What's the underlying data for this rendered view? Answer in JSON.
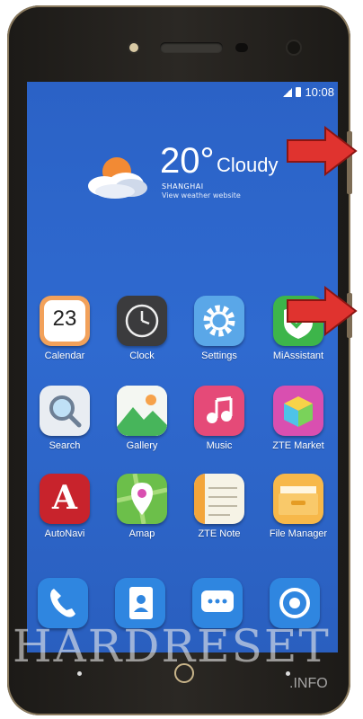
{
  "status": {
    "time": "10:08"
  },
  "weather": {
    "temperature": "20°",
    "condition": "Cloudy",
    "city": "SHANGHAI",
    "subtitle": "View weather website"
  },
  "apps": [
    {
      "label": "Calendar",
      "icon": "calendar-icon",
      "day": "23"
    },
    {
      "label": "Clock",
      "icon": "clock-icon"
    },
    {
      "label": "Settings",
      "icon": "gear-icon"
    },
    {
      "label": "MiAssistant",
      "icon": "shield-icon"
    },
    {
      "label": "Search",
      "icon": "search-icon"
    },
    {
      "label": "Gallery",
      "icon": "gallery-icon"
    },
    {
      "label": "Music",
      "icon": "music-icon"
    },
    {
      "label": "ZTE Market",
      "icon": "cube-icon"
    },
    {
      "label": "AutoNavi",
      "icon": "autonavi-icon",
      "glyph": "A"
    },
    {
      "label": "Amap",
      "icon": "map-pin-icon"
    },
    {
      "label": "ZTE Note",
      "icon": "notepad-icon"
    },
    {
      "label": "File Manager",
      "icon": "folder-icon"
    }
  ],
  "dock": [
    {
      "icon": "phone-icon"
    },
    {
      "icon": "contacts-icon"
    },
    {
      "icon": "messages-icon"
    },
    {
      "icon": "browser-icon"
    },
    {
      "icon": "camera-icon"
    }
  ],
  "watermark": {
    "brand": "HARDRESET",
    "suffix": ".INFO"
  },
  "colors": {
    "screen": "#2f6ad0",
    "arrow": "#e0332f",
    "bezel": "#24211e"
  }
}
